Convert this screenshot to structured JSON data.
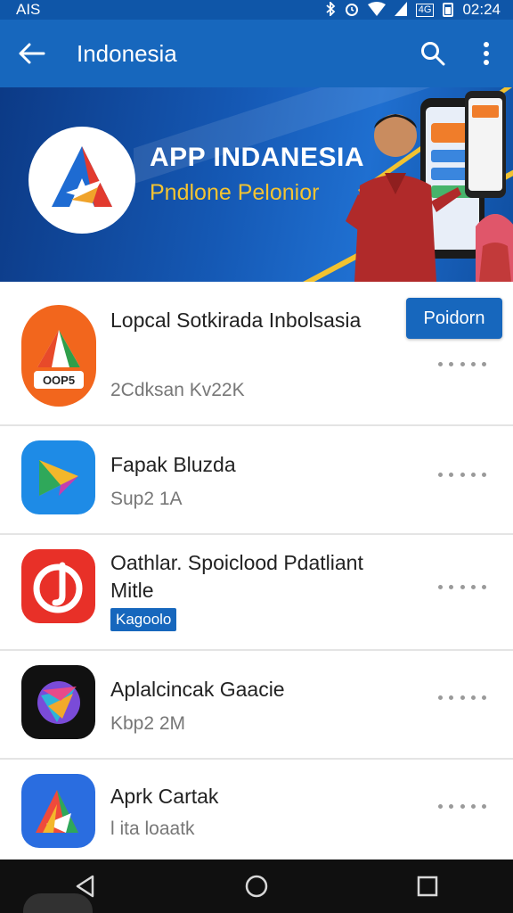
{
  "status_bar": {
    "carrier": "AIS",
    "net_badge": "4G",
    "time": "02:24"
  },
  "app_bar": {
    "title": "Indonesia",
    "back_icon": "arrow-left-icon",
    "search_icon": "search-icon",
    "menu_icon": "more-vert-icon"
  },
  "banner": {
    "headline": "APP INDANESIA",
    "subline": "Pndlone Pelonior"
  },
  "apps": [
    {
      "name": "Lopcal Sotkirada Inbolsasia",
      "meta": "2Cdksan Kv22K",
      "action": "Poidorn",
      "icon_label": "OOP5",
      "icon_colors": [
        "#f26a1b",
        "#ffffff"
      ]
    },
    {
      "name": "Fapak Bluzda",
      "meta": "Sup2 1A",
      "icon_colors": [
        "#1e8be6",
        "#f3b72b"
      ]
    },
    {
      "name": "Oathlar. Spoiclood Pdatliant Mitle",
      "badge": "Kagoolo",
      "icon_colors": [
        "#e83028",
        "#ffffff"
      ]
    },
    {
      "name": "Aplalcincak Gaacie",
      "meta": "Kbp2 2M",
      "icon_colors": [
        "#111111",
        "#7a4bd8"
      ]
    },
    {
      "name": "Aprk Cartak",
      "meta": "l ita loaatk",
      "icon_colors": [
        "#2a6de0",
        "#ef4a3b"
      ]
    }
  ],
  "nav_bar": {
    "back_icon": "triangle-back-icon",
    "home_icon": "circle-home-icon",
    "recents_icon": "square-recents-icon"
  }
}
